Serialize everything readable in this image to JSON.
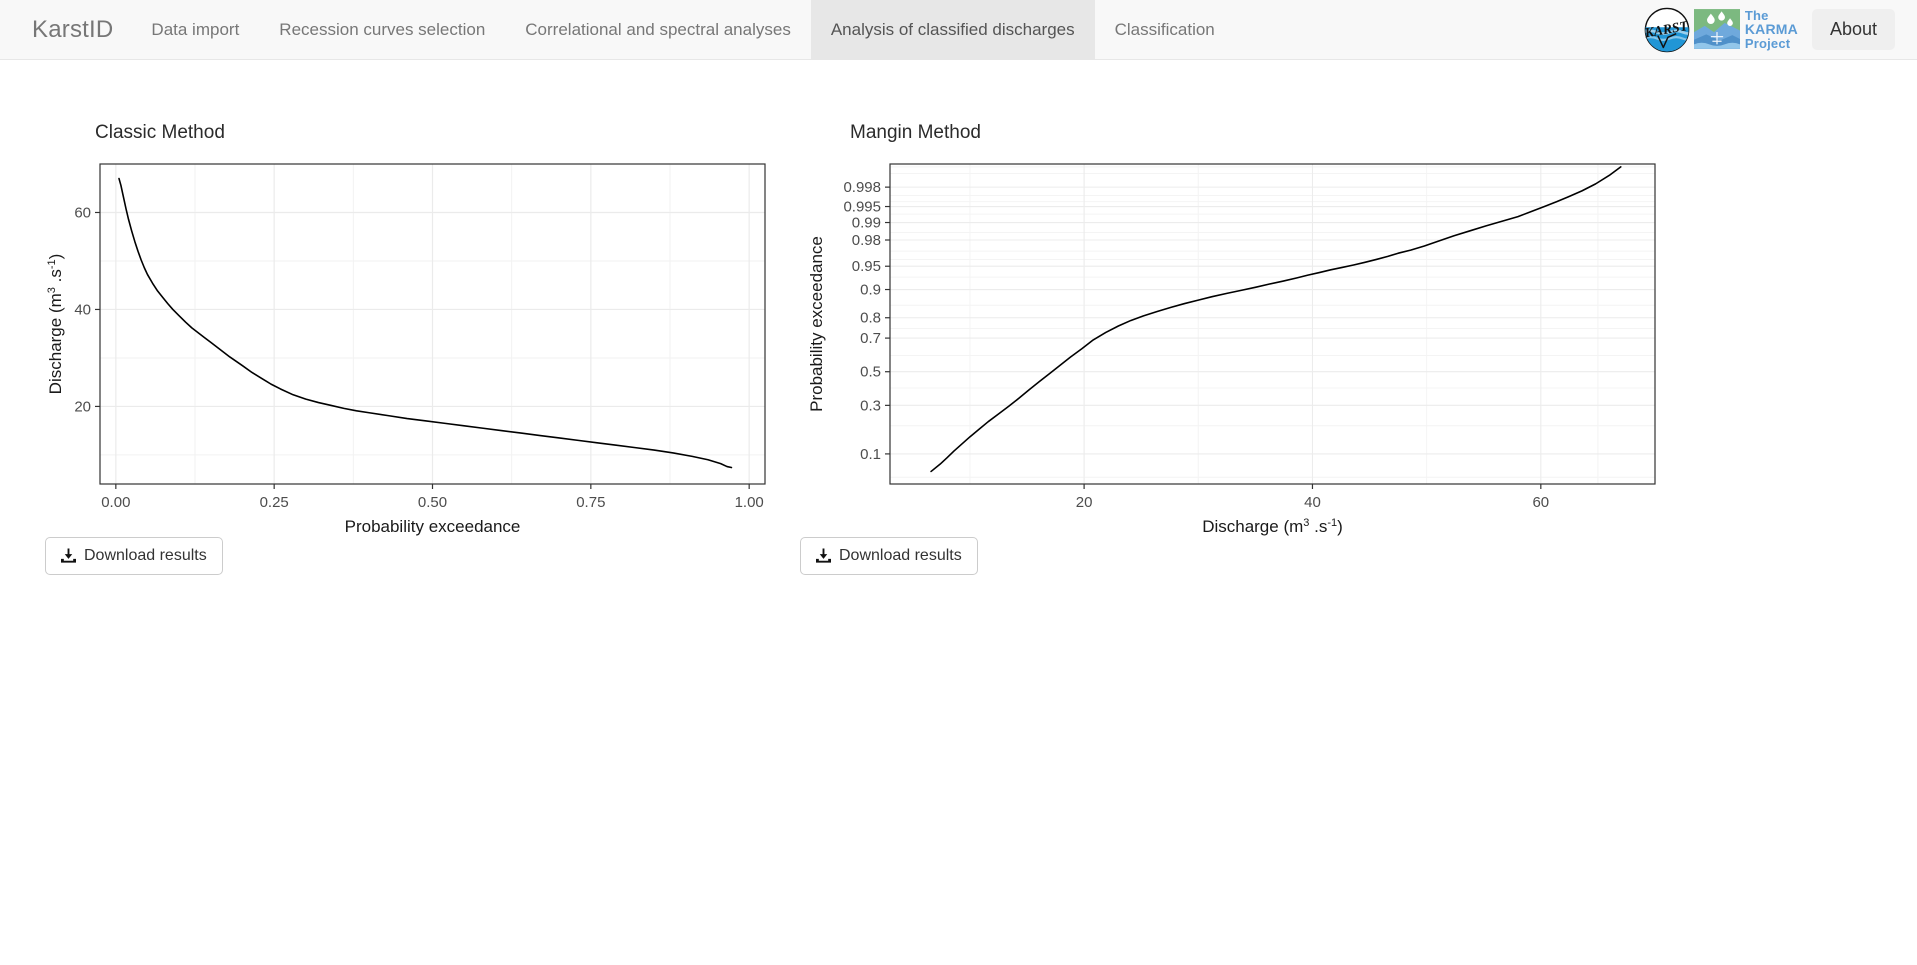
{
  "navbar": {
    "brand": "KarstID",
    "tabs": [
      {
        "label": "Data import",
        "active": false
      },
      {
        "label": "Recession curves selection",
        "active": false
      },
      {
        "label": "Correlational and spectral analyses",
        "active": false
      },
      {
        "label": "Analysis of classified discharges",
        "active": true
      },
      {
        "label": "Classification",
        "active": false
      }
    ],
    "logos": {
      "karst_alt": "karst-logo",
      "karst_text": "KARST",
      "karma_line1": "The",
      "karma_line2": "KARMA",
      "karma_line3": "Project"
    },
    "about_label": "About",
    "colors": {
      "bar_bg": "#f8f8f8",
      "active_tab_bg": "#e7e7e7",
      "link": "#777777",
      "karma_blue": "#5b9bd5",
      "karma_green": "#7cb980"
    }
  },
  "panels": [
    {
      "id": "classic",
      "title": "Classic Method",
      "download_label": "Download results",
      "download_icon": "download-icon"
    },
    {
      "id": "mangin",
      "title": "Mangin Method",
      "download_label": "Download results",
      "download_icon": "download-icon"
    }
  ],
  "chart_data": [
    {
      "type": "line",
      "id": "classic",
      "title": "Classic Method",
      "xlabel": "Probability exceedance",
      "ylabel": "Discharge (m3 .s-1)",
      "ylabel_parts": {
        "base": "Discharge (m",
        "sup1": "3",
        "mid": " .s",
        "sup2": "-1",
        "close": ")"
      },
      "xticks": [
        "0.00",
        "0.25",
        "0.50",
        "0.75",
        "1.00"
      ],
      "xtick_values": [
        0.0,
        0.25,
        0.5,
        0.75,
        1.0
      ],
      "yticks": [
        "20",
        "40",
        "60"
      ],
      "ytick_values": [
        20,
        40,
        60
      ],
      "xlim": [
        -0.025,
        1.025
      ],
      "ylim": [
        4,
        70
      ],
      "grid": true,
      "legend": "none",
      "x": [
        0.005,
        0.008,
        0.012,
        0.016,
        0.02,
        0.025,
        0.03,
        0.035,
        0.04,
        0.045,
        0.05,
        0.058,
        0.066,
        0.074,
        0.082,
        0.09,
        0.1,
        0.11,
        0.12,
        0.13,
        0.14,
        0.15,
        0.16,
        0.17,
        0.18,
        0.19,
        0.2,
        0.215,
        0.23,
        0.245,
        0.26,
        0.28,
        0.3,
        0.32,
        0.34,
        0.36,
        0.38,
        0.4,
        0.43,
        0.46,
        0.49,
        0.52,
        0.55,
        0.58,
        0.61,
        0.64,
        0.67,
        0.7,
        0.73,
        0.76,
        0.79,
        0.82,
        0.85,
        0.88,
        0.91,
        0.935,
        0.955,
        0.965,
        0.972
      ],
      "y": [
        67.0,
        65.6,
        63.2,
        60.8,
        58.6,
        56.2,
        54.0,
        52.0,
        50.2,
        48.6,
        47.2,
        45.4,
        43.8,
        42.5,
        41.2,
        40.0,
        38.7,
        37.4,
        36.2,
        35.2,
        34.2,
        33.2,
        32.2,
        31.2,
        30.2,
        29.3,
        28.4,
        27.0,
        25.8,
        24.6,
        23.6,
        22.4,
        21.5,
        20.8,
        20.2,
        19.6,
        19.1,
        18.7,
        18.1,
        17.5,
        17.0,
        16.5,
        16.0,
        15.5,
        15.0,
        14.5,
        14.0,
        13.5,
        13.0,
        12.5,
        12.0,
        11.5,
        11.0,
        10.4,
        9.7,
        9.0,
        8.2,
        7.6,
        7.4
      ],
      "line_color": "#000000",
      "line_width": 1.6
    },
    {
      "type": "line",
      "id": "mangin",
      "title": "Mangin Method",
      "xlabel": "Discharge (m3 .s-1)",
      "xlabel_parts": {
        "base": "Discharge (m",
        "sup1": "3",
        "mid": " .s",
        "sup2": "-1",
        "close": ")"
      },
      "ylabel": "Probability exceedance",
      "xticks": [
        "20",
        "40",
        "60"
      ],
      "xtick_values": [
        20,
        40,
        60
      ],
      "yticks": [
        "0.1",
        "0.3",
        "0.5",
        "0.7",
        "0.8",
        "0.9",
        "0.95",
        "0.98",
        "0.99",
        "0.995",
        "0.998"
      ],
      "ytick_values": [
        0.1,
        0.3,
        0.5,
        0.7,
        0.8,
        0.9,
        0.95,
        0.98,
        0.99,
        0.995,
        0.998
      ],
      "y_scale": "probit",
      "xlim": [
        3,
        70
      ],
      "ylim_probit": [
        0.04,
        0.9994
      ],
      "grid": true,
      "legend": "none",
      "x": [
        6.6,
        7.4,
        8.0,
        8.6,
        9.3,
        10.0,
        10.8,
        11.6,
        12.5,
        13.4,
        14.3,
        15.2,
        16.1,
        17.0,
        17.9,
        18.8,
        19.8,
        20.8,
        21.9,
        23.0,
        24.1,
        25.2,
        26.4,
        27.6,
        28.8,
        30.0,
        31.2,
        32.5,
        33.8,
        35.0,
        36.2,
        37.4,
        38.6,
        39.6,
        40.6,
        41.6,
        42.6,
        43.6,
        44.6,
        45.6,
        46.6,
        47.6,
        48.6,
        49.8,
        51.0,
        52.4,
        53.8,
        55.2,
        56.6,
        58.0,
        59.2,
        60.4,
        61.4,
        62.4,
        63.6,
        64.8,
        66.0,
        67.0
      ],
      "y": [
        0.06,
        0.075,
        0.09,
        0.108,
        0.13,
        0.155,
        0.185,
        0.218,
        0.255,
        0.295,
        0.34,
        0.39,
        0.44,
        0.49,
        0.54,
        0.59,
        0.64,
        0.69,
        0.73,
        0.762,
        0.788,
        0.808,
        0.826,
        0.842,
        0.856,
        0.868,
        0.879,
        0.889,
        0.898,
        0.906,
        0.914,
        0.921,
        0.928,
        0.934,
        0.939,
        0.944,
        0.948,
        0.952,
        0.956,
        0.96,
        0.964,
        0.968,
        0.971,
        0.975,
        0.979,
        0.983,
        0.986,
        0.9885,
        0.9905,
        0.9922,
        0.9938,
        0.9951,
        0.996,
        0.9968,
        0.9976,
        0.9983,
        0.9989,
        0.9993
      ],
      "line_color": "#000000",
      "line_width": 1.6
    }
  ]
}
